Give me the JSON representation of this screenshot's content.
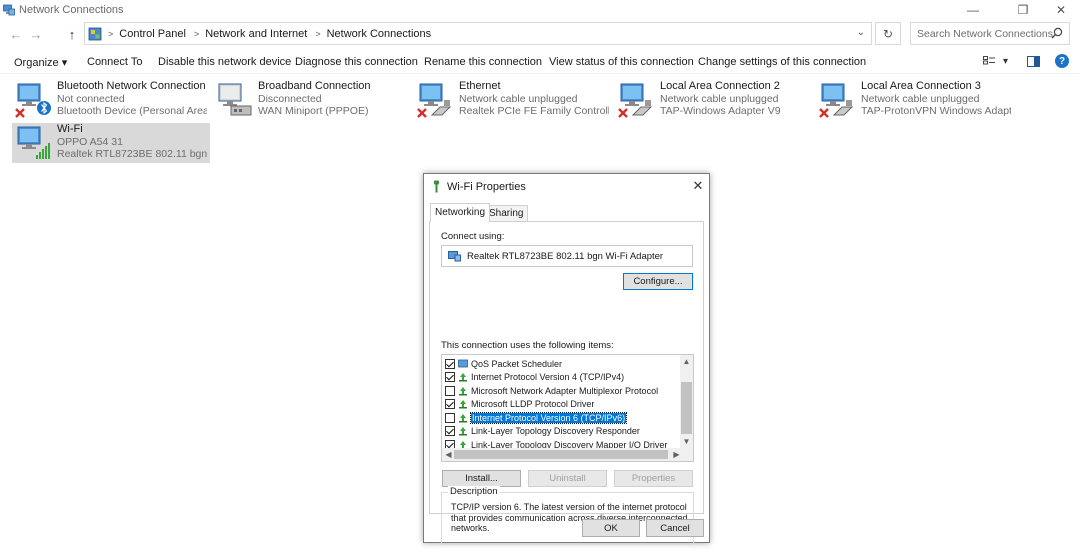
{
  "window": {
    "title": "Network Connections",
    "controls": {
      "minimize": "—",
      "restore": "❐",
      "close": "✕"
    }
  },
  "nav": {
    "back": "←",
    "forward": "→",
    "up": "↑",
    "breadcrumbs": [
      "Control Panel",
      "Network and Internet",
      "Network Connections"
    ],
    "dropdown": "⌄",
    "refresh": "↻",
    "search_placeholder": "Search Network Connections"
  },
  "toolbar": {
    "commands": [
      "Organize ▾",
      "Connect To",
      "Disable this network device",
      "Diagnose this connection",
      "Rename this connection",
      "View status of this connection",
      "Change settings of this connection"
    ],
    "view_dropdown": "▾",
    "help": "?"
  },
  "connections": [
    {
      "name": "Bluetooth Network Connection",
      "status": "Not connected",
      "device": "Bluetooth Device (Personal Area ...",
      "icon": "bluetooth-network-icon",
      "badge": "disconnected"
    },
    {
      "name": "Broadband Connection",
      "status": "Disconnected",
      "device": "WAN Miniport (PPPOE)",
      "icon": "broadband-network-icon",
      "badge": "none"
    },
    {
      "name": "Ethernet",
      "status": "Network cable unplugged",
      "device": "Realtek PCIe FE Family Controller",
      "icon": "ethernet-network-icon",
      "badge": "disconnected"
    },
    {
      "name": "Local Area Connection 2",
      "status": "Network cable unplugged",
      "device": "TAP-Windows Adapter V9",
      "icon": "lan-network-icon",
      "badge": "disconnected"
    },
    {
      "name": "Local Area Connection 3",
      "status": "Network cable unplugged",
      "device": "TAP-ProtonVPN Windows Adapte...",
      "icon": "lan-network-icon",
      "badge": "disconnected"
    },
    {
      "name": "Wi-Fi",
      "status": "OPPO A54 31",
      "device": "Realtek RTL8723BE 802.11 bgn Wi-...",
      "icon": "wifi-network-icon",
      "badge": "signal"
    }
  ],
  "dialog": {
    "title": "Wi-Fi Properties",
    "close": "✕",
    "tabs": [
      "Networking",
      "Sharing"
    ],
    "connect_using_label": "Connect using:",
    "adapter": "Realtek RTL8723BE 802.11 bgn Wi-Fi Adapter",
    "configure_label": "Configure...",
    "items_label": "This connection uses the following items:",
    "items": [
      {
        "label": "QoS Packet Scheduler",
        "checked": true,
        "selected": false
      },
      {
        "label": "Internet Protocol Version 4 (TCP/IPv4)",
        "checked": true,
        "selected": false
      },
      {
        "label": "Microsoft Network Adapter Multiplexor Protocol",
        "checked": false,
        "selected": false
      },
      {
        "label": "Microsoft LLDP Protocol Driver",
        "checked": true,
        "selected": false
      },
      {
        "label": "Internet Protocol Version 6 (TCP/IPv6)",
        "checked": false,
        "selected": true
      },
      {
        "label": "Link-Layer Topology Discovery Responder",
        "checked": true,
        "selected": false
      },
      {
        "label": "Link-Layer Topology Discovery Mapper I/O Driver",
        "checked": true,
        "selected": false
      }
    ],
    "scroll_up": "▲",
    "scroll_down": "▼",
    "scroll_left": "◀",
    "scroll_right": "▶",
    "install_label": "Install...",
    "uninstall_label": "Uninstall",
    "properties_label": "Properties",
    "description_label": "Description",
    "description_text": "TCP/IP version 6. The latest version of the internet protocol that provides communication across diverse interconnected networks.",
    "ok_label": "OK",
    "cancel_label": "Cancel"
  },
  "colors": {
    "selection": "#0078d7",
    "item_selected_bg": "#d9d9d9",
    "help_blue": "#1a73c9",
    "error_red": "#d0312d",
    "signal_green": "#3aa53a"
  }
}
